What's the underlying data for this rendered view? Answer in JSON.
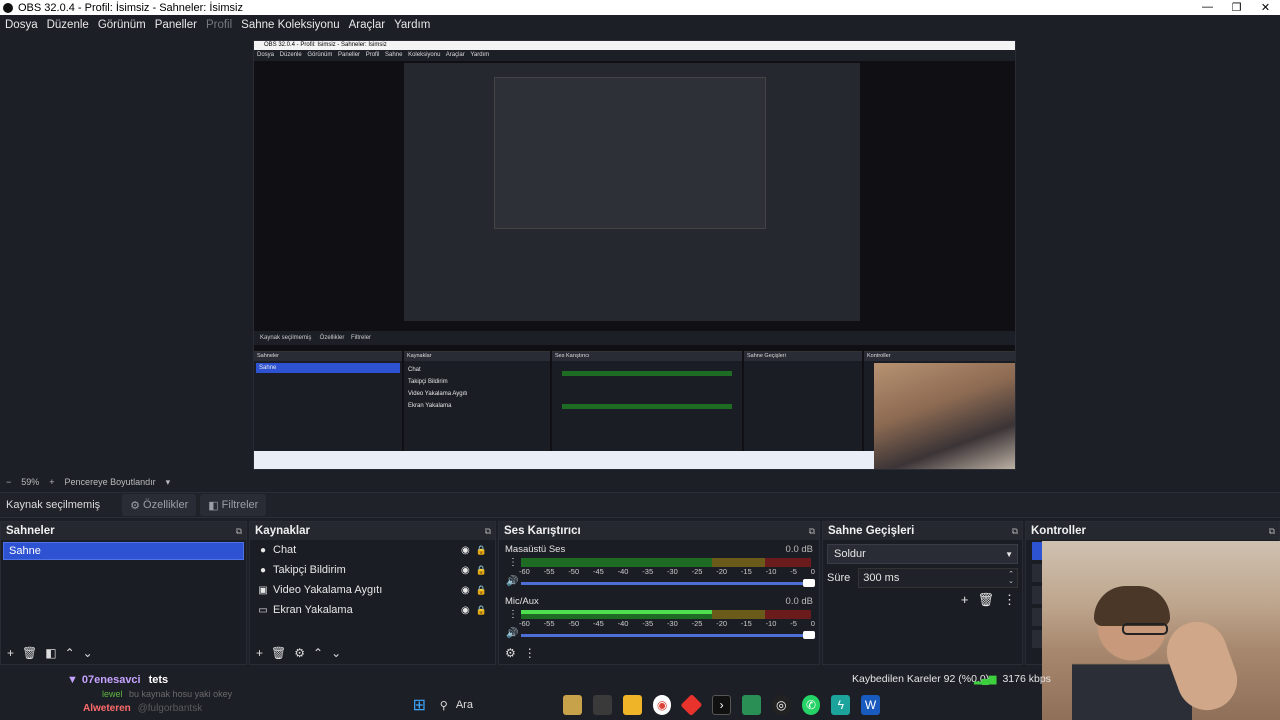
{
  "window": {
    "title": "OBS 32.0.4 - Profil: İsimsiz - Sahneler: İsimsiz",
    "controls": [
      "—",
      "❐",
      "✕"
    ]
  },
  "menu": [
    {
      "label": "Dosya",
      "disabled": false
    },
    {
      "label": "Düzenle",
      "disabled": false
    },
    {
      "label": "Görünüm",
      "disabled": false
    },
    {
      "label": "Paneller",
      "disabled": false
    },
    {
      "label": "Profil",
      "disabled": true
    },
    {
      "label": "Sahne Koleksiyonu",
      "disabled": false
    },
    {
      "label": "Araçlar",
      "disabled": false
    },
    {
      "label": "Yardım",
      "disabled": false
    }
  ],
  "zoom": {
    "minus": "−",
    "value": "59%",
    "plus": "+",
    "resize_label": "Pencereye Boyutlandır",
    "chevron": "▾"
  },
  "context": {
    "label": "Kaynak seçilmemiş",
    "properties": "Özellikler",
    "filters": "Filtreler"
  },
  "scenes": {
    "title": "Sahneler",
    "items": [
      "Sahne"
    ]
  },
  "sources": {
    "title": "Kaynaklar",
    "items": [
      {
        "name": "Chat",
        "icon": "browser-icon",
        "glyph": "●"
      },
      {
        "name": "Takipçi Bildirim",
        "icon": "browser-icon",
        "glyph": "●"
      },
      {
        "name": "Video Yakalama Aygıtı",
        "icon": "camera-icon",
        "glyph": "▣"
      },
      {
        "name": "Ekran Yakalama",
        "icon": "monitor-icon",
        "glyph": "▭"
      }
    ]
  },
  "mixer": {
    "title": "Ses Karıştırıcı",
    "channels": [
      {
        "name": "Masaüstü Ses",
        "db": "0.0 dB",
        "level": 0
      },
      {
        "name": "Mic/Aux",
        "db": "0.0 dB",
        "level": 0.66
      }
    ],
    "ticks": [
      "-60",
      "-55",
      "-50",
      "-45",
      "-40",
      "-35",
      "-30",
      "-25",
      "-20",
      "-15",
      "-10",
      "-5",
      "0"
    ]
  },
  "transitions": {
    "title": "Sahne Geçişleri",
    "selected": "Soldur",
    "duration_label": "Süre",
    "duration_value": "300 ms"
  },
  "controls": {
    "title": "Kontroller"
  },
  "status": {
    "dropped": "Kaybedilen Kareler 92 (%0.0)",
    "kbps": "3176 kbps"
  },
  "chat": [
    {
      "user": "07enesavci",
      "message": "tets"
    },
    {
      "user": "lewel",
      "message": "bu kaynak hosu yaki okey"
    },
    {
      "user": "Alweteren",
      "message": "@fulgorbantsk"
    }
  ],
  "taskbar": {
    "search": "Ara"
  },
  "colors": {
    "accent": "#2d53d3",
    "background": "#1d1f27",
    "meter_green": "#4fe04f"
  }
}
